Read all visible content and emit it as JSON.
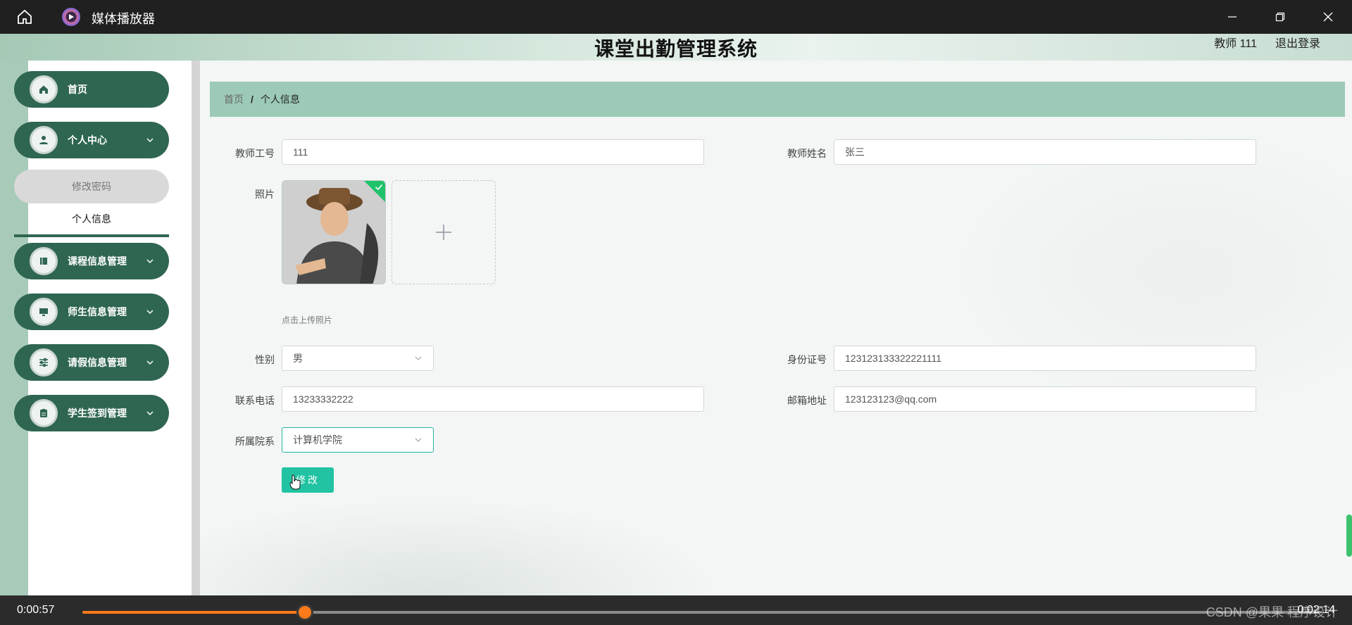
{
  "player": {
    "title": "媒体播放器",
    "current_time": "0:00:57",
    "total_time": "0:02:14",
    "progress": 0.18,
    "watermark": "CSDN @果果 程序设计"
  },
  "header": {
    "title": "课堂出勤管理系统",
    "user": "教师 111",
    "logout": "退出登录"
  },
  "sidebar": {
    "items": [
      {
        "label": "首页",
        "icon": "home-icon"
      },
      {
        "label": "个人中心",
        "icon": "user-icon"
      },
      {
        "label": "课程信息管理",
        "icon": "book-icon"
      },
      {
        "label": "师生信息管理",
        "icon": "monitor-icon"
      },
      {
        "label": "请假信息管理",
        "icon": "sliders-icon"
      },
      {
        "label": "学生签到管理",
        "icon": "clipboard-icon"
      }
    ],
    "sub_items": [
      {
        "label": "修改密码"
      },
      {
        "label": "个人信息"
      }
    ]
  },
  "breadcrumb": {
    "home": "首页",
    "separator": "/",
    "current": "个人信息"
  },
  "form": {
    "teacher_id_label": "教师工号",
    "teacher_id_value": "111",
    "teacher_name_label": "教师姓名",
    "teacher_name_value": "张三",
    "photo_label": "照片",
    "upload_hint": "点击上传照片",
    "gender_label": "性别",
    "gender_value": "男",
    "id_card_label": "身份证号",
    "id_card_value": "123123133322221111",
    "phone_label": "联系电话",
    "phone_value": "13233332222",
    "email_label": "邮箱地址",
    "email_value": "123123123@qq.com",
    "department_label": "所属院系",
    "department_value": "计算机学院",
    "submit_label": "修改"
  },
  "colors": {
    "menu_green": "#2f6651",
    "breadcrumb_bg": "#9ccab7",
    "accent_teal": "#21c3a2",
    "progress_orange": "#ff7a1a"
  }
}
